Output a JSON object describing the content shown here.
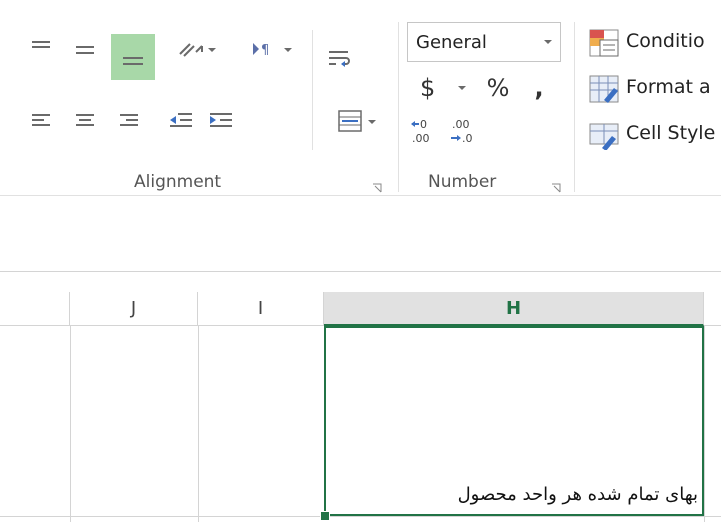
{
  "ribbon": {
    "alignment": {
      "label": "Alignment"
    },
    "number": {
      "label": "Number",
      "format_value": "General",
      "currency_symbol": "$",
      "percent_symbol": "%",
      "comma_symbol": ","
    },
    "styles": {
      "conditional_label": "Conditio",
      "format_table_label": "Format a",
      "cell_styles_label": "Cell Style"
    }
  },
  "sheet": {
    "columns": [
      {
        "label": ""
      },
      {
        "label": "J"
      },
      {
        "label": "I"
      },
      {
        "label": "H"
      }
    ],
    "active_cell_text": "بهای تمام شده هر واحد محصول"
  },
  "colors": {
    "accent": "#217346",
    "selected_button": "#a8d8a8"
  }
}
